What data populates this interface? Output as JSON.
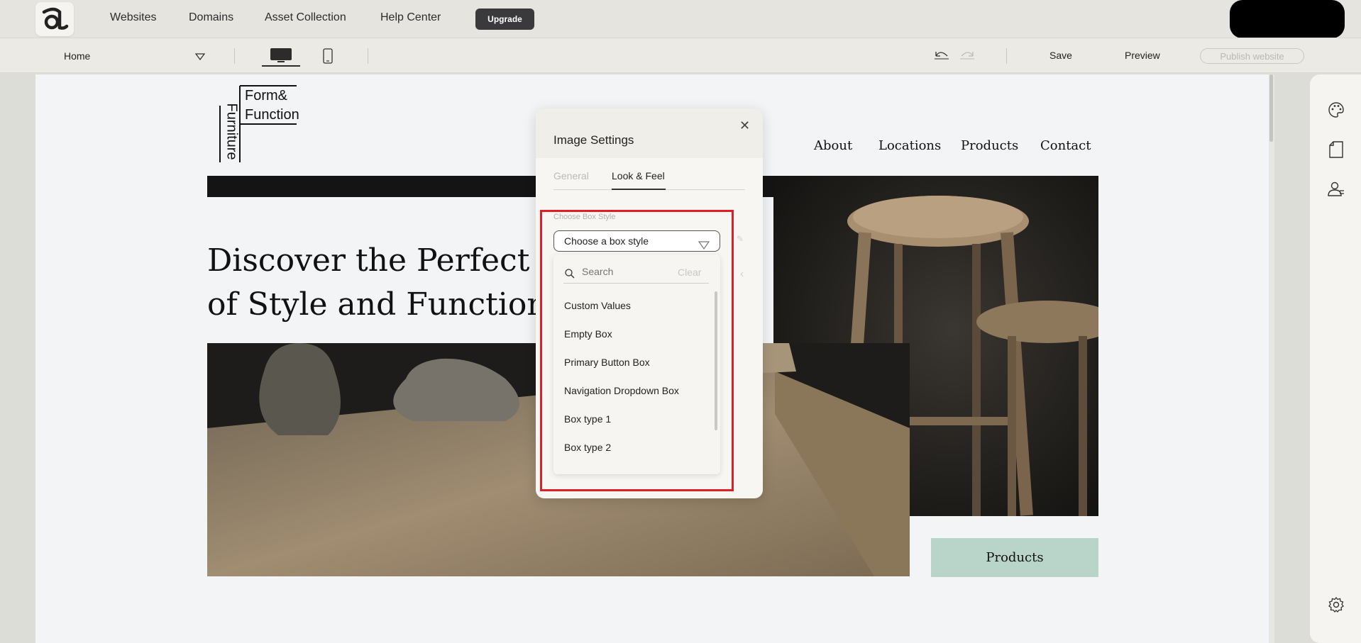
{
  "topbar": {
    "nav": [
      "Websites",
      "Domains",
      "Asset Collection",
      "Help Center"
    ],
    "upgrade_label": "Upgrade"
  },
  "toolbar": {
    "page_name": "Home",
    "save_label": "Save",
    "preview_label": "Preview",
    "publish_label": "Publish website"
  },
  "site": {
    "logo": {
      "line1": "Form&",
      "line2": "Function",
      "vertical": "Furniture"
    },
    "nav": [
      "About",
      "Locations",
      "Products",
      "Contact"
    ],
    "headline_line1": "Discover the Perfect B",
    "headline_line2": "of Style and Function",
    "products_button": "Products"
  },
  "panel": {
    "title": "Image Settings",
    "tabs": [
      "General",
      "Look & Feel"
    ],
    "active_tab": "Look & Feel",
    "field_label": "Choose Box Style",
    "select_value": "Choose a box style",
    "search_placeholder": "Search",
    "clear_label": "Clear",
    "options": [
      "Custom Values",
      "Empty Box",
      "Primary Button Box",
      "Navigation Dropdown Box",
      "Box type 1",
      "Box type 2"
    ]
  },
  "colors": {
    "accent_highlight": "#e11d26",
    "products_button": "#b9d4c9",
    "upgrade_button": "#3a3a3c"
  }
}
